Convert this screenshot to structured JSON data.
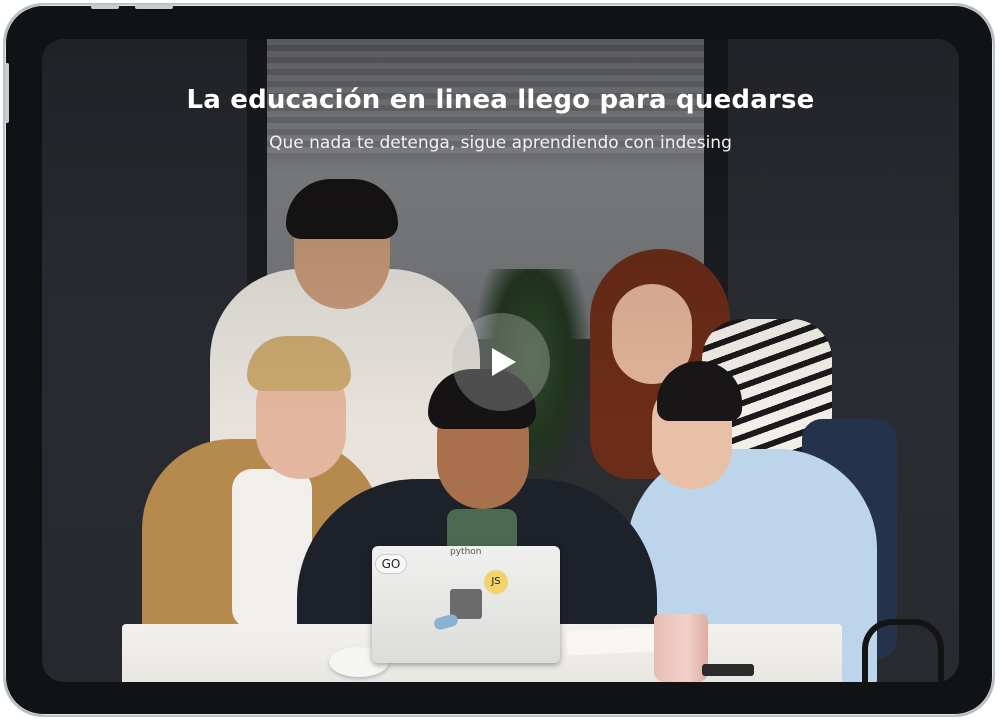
{
  "hero": {
    "title": "La educación en linea llego para quedarse",
    "subtitle": "Que nada te detenga, sigue aprendiendo con indesing"
  },
  "video": {
    "play_icon": "play-icon"
  },
  "photo_stickers": {
    "go": "GO",
    "python": "python",
    "js": "JS"
  },
  "colors": {
    "device_frame": "#111214",
    "text": "#ffffff"
  }
}
